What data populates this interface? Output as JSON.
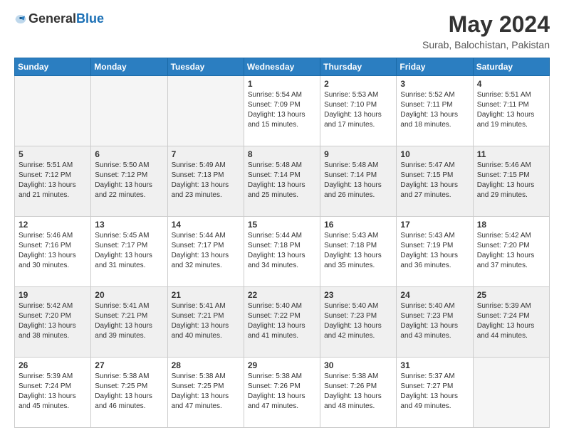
{
  "header": {
    "logo_general": "General",
    "logo_blue": "Blue",
    "month_year": "May 2024",
    "location": "Surab, Balochistan, Pakistan"
  },
  "weekdays": [
    "Sunday",
    "Monday",
    "Tuesday",
    "Wednesday",
    "Thursday",
    "Friday",
    "Saturday"
  ],
  "weeks": [
    [
      {
        "day": "",
        "empty": true
      },
      {
        "day": "",
        "empty": true
      },
      {
        "day": "",
        "empty": true
      },
      {
        "day": "1",
        "sunrise": "5:54 AM",
        "sunset": "7:09 PM",
        "daylight": "13 hours and 15 minutes."
      },
      {
        "day": "2",
        "sunrise": "5:53 AM",
        "sunset": "7:10 PM",
        "daylight": "13 hours and 17 minutes."
      },
      {
        "day": "3",
        "sunrise": "5:52 AM",
        "sunset": "7:11 PM",
        "daylight": "13 hours and 18 minutes."
      },
      {
        "day": "4",
        "sunrise": "5:51 AM",
        "sunset": "7:11 PM",
        "daylight": "13 hours and 19 minutes."
      }
    ],
    [
      {
        "day": "5",
        "sunrise": "5:51 AM",
        "sunset": "7:12 PM",
        "daylight": "13 hours and 21 minutes."
      },
      {
        "day": "6",
        "sunrise": "5:50 AM",
        "sunset": "7:12 PM",
        "daylight": "13 hours and 22 minutes."
      },
      {
        "day": "7",
        "sunrise": "5:49 AM",
        "sunset": "7:13 PM",
        "daylight": "13 hours and 23 minutes."
      },
      {
        "day": "8",
        "sunrise": "5:48 AM",
        "sunset": "7:14 PM",
        "daylight": "13 hours and 25 minutes."
      },
      {
        "day": "9",
        "sunrise": "5:48 AM",
        "sunset": "7:14 PM",
        "daylight": "13 hours and 26 minutes."
      },
      {
        "day": "10",
        "sunrise": "5:47 AM",
        "sunset": "7:15 PM",
        "daylight": "13 hours and 27 minutes."
      },
      {
        "day": "11",
        "sunrise": "5:46 AM",
        "sunset": "7:15 PM",
        "daylight": "13 hours and 29 minutes."
      }
    ],
    [
      {
        "day": "12",
        "sunrise": "5:46 AM",
        "sunset": "7:16 PM",
        "daylight": "13 hours and 30 minutes."
      },
      {
        "day": "13",
        "sunrise": "5:45 AM",
        "sunset": "7:17 PM",
        "daylight": "13 hours and 31 minutes."
      },
      {
        "day": "14",
        "sunrise": "5:44 AM",
        "sunset": "7:17 PM",
        "daylight": "13 hours and 32 minutes."
      },
      {
        "day": "15",
        "sunrise": "5:44 AM",
        "sunset": "7:18 PM",
        "daylight": "13 hours and 34 minutes."
      },
      {
        "day": "16",
        "sunrise": "5:43 AM",
        "sunset": "7:18 PM",
        "daylight": "13 hours and 35 minutes."
      },
      {
        "day": "17",
        "sunrise": "5:43 AM",
        "sunset": "7:19 PM",
        "daylight": "13 hours and 36 minutes."
      },
      {
        "day": "18",
        "sunrise": "5:42 AM",
        "sunset": "7:20 PM",
        "daylight": "13 hours and 37 minutes."
      }
    ],
    [
      {
        "day": "19",
        "sunrise": "5:42 AM",
        "sunset": "7:20 PM",
        "daylight": "13 hours and 38 minutes."
      },
      {
        "day": "20",
        "sunrise": "5:41 AM",
        "sunset": "7:21 PM",
        "daylight": "13 hours and 39 minutes."
      },
      {
        "day": "21",
        "sunrise": "5:41 AM",
        "sunset": "7:21 PM",
        "daylight": "13 hours and 40 minutes."
      },
      {
        "day": "22",
        "sunrise": "5:40 AM",
        "sunset": "7:22 PM",
        "daylight": "13 hours and 41 minutes."
      },
      {
        "day": "23",
        "sunrise": "5:40 AM",
        "sunset": "7:23 PM",
        "daylight": "13 hours and 42 minutes."
      },
      {
        "day": "24",
        "sunrise": "5:40 AM",
        "sunset": "7:23 PM",
        "daylight": "13 hours and 43 minutes."
      },
      {
        "day": "25",
        "sunrise": "5:39 AM",
        "sunset": "7:24 PM",
        "daylight": "13 hours and 44 minutes."
      }
    ],
    [
      {
        "day": "26",
        "sunrise": "5:39 AM",
        "sunset": "7:24 PM",
        "daylight": "13 hours and 45 minutes."
      },
      {
        "day": "27",
        "sunrise": "5:38 AM",
        "sunset": "7:25 PM",
        "daylight": "13 hours and 46 minutes."
      },
      {
        "day": "28",
        "sunrise": "5:38 AM",
        "sunset": "7:25 PM",
        "daylight": "13 hours and 47 minutes."
      },
      {
        "day": "29",
        "sunrise": "5:38 AM",
        "sunset": "7:26 PM",
        "daylight": "13 hours and 47 minutes."
      },
      {
        "day": "30",
        "sunrise": "5:38 AM",
        "sunset": "7:26 PM",
        "daylight": "13 hours and 48 minutes."
      },
      {
        "day": "31",
        "sunrise": "5:37 AM",
        "sunset": "7:27 PM",
        "daylight": "13 hours and 49 minutes."
      },
      {
        "day": "",
        "empty": true
      }
    ]
  ]
}
